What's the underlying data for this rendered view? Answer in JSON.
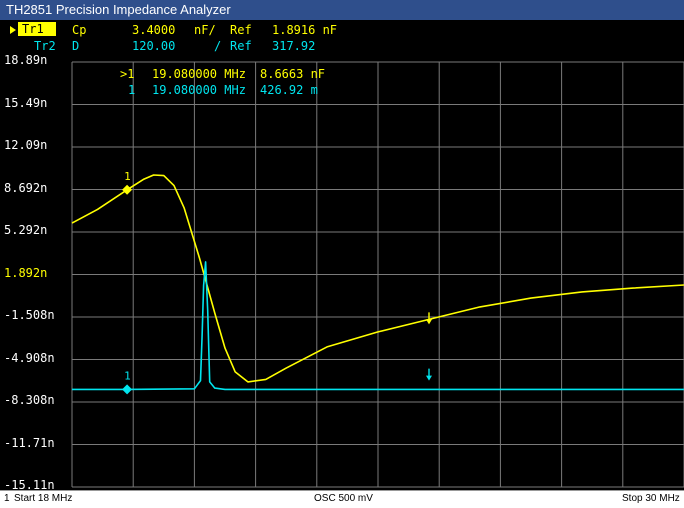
{
  "window": {
    "title": "TH2851 Precision Impedance Analyzer"
  },
  "traces": [
    {
      "label": "Tr1",
      "param": "Cp",
      "scale": "3.4000",
      "unit_sep": "nF/",
      "ref_label": "Ref",
      "ref_value": "1.8916 nF",
      "color": "#ffff00",
      "active": true
    },
    {
      "label": "Tr2",
      "param": "D",
      "scale": "120.00",
      "unit_sep": "/",
      "ref_label": "Ref",
      "ref_value": "317.92",
      "color": "#00e5ee",
      "active": false
    }
  ],
  "marker_readout": [
    {
      "prefix": ">1",
      "freq": "19.080000 MHz",
      "value": "8.6663 nF"
    },
    {
      "prefix": "1",
      "freq": "19.080000 MHz",
      "value": "426.92 m"
    }
  ],
  "y_axis_labels": [
    "18.89n",
    "15.49n",
    "12.09n",
    "8.692n",
    "5.292n",
    "1.892n",
    "-1.508n",
    "-4.908n",
    "-8.308n",
    "-11.71n",
    "-15.11n"
  ],
  "reference_label_index": 5,
  "marker_number_label": "1",
  "status": {
    "channel": "1",
    "start": "Start 18 MHz",
    "osc": "OSC 500 mV",
    "stop": "Stop 30 MHz"
  },
  "colors": {
    "background": "#000000",
    "grid": "#7a7a7a",
    "trace1": "#ffff00",
    "trace2": "#00e5ee",
    "axis_label": "#ffffff",
    "titlebar": "#2f4f8c"
  },
  "chart_data": {
    "type": "line",
    "x_range": [
      18,
      30
    ],
    "x_unit": "MHz",
    "y_range": [
      -15.11,
      18.89
    ],
    "series": [
      {
        "name": "Tr1",
        "param": "Cp",
        "x": [
          18,
          18.5,
          19.08,
          19.4,
          19.6,
          19.8,
          20.0,
          20.2,
          20.5,
          20.8,
          21.0,
          21.2,
          21.45,
          21.8,
          22.2,
          23.0,
          24.0,
          25.0,
          26.0,
          27.0,
          28.0,
          29.0,
          30.0
        ],
        "y": [
          6.0,
          7.1,
          8.67,
          9.5,
          9.85,
          9.8,
          9.0,
          7.2,
          3.2,
          -1.2,
          -4.0,
          -5.9,
          -6.7,
          -6.5,
          -5.6,
          -3.9,
          -2.7,
          -1.7,
          -0.7,
          0.0,
          0.5,
          0.8,
          1.05
        ]
      },
      {
        "name": "Tr2",
        "param": "D",
        "x": [
          18,
          19.08,
          20.4,
          20.52,
          20.55,
          20.58,
          20.62,
          20.66,
          20.7,
          20.8,
          21.0,
          24.0,
          30.0
        ],
        "y": [
          -7.3,
          -7.3,
          -7.25,
          -6.6,
          -3.0,
          1.0,
          2.9,
          -1.0,
          -6.7,
          -7.2,
          -7.3,
          -7.3,
          -7.3
        ]
      }
    ],
    "markers": [
      {
        "trace": "Tr1",
        "x": 19.08,
        "y": 8.6663
      },
      {
        "trace": "Tr2",
        "x": 19.08,
        "y": -7.3
      }
    ],
    "ref_arrows": [
      {
        "trace": "Tr1",
        "x": 25.0,
        "y": -2.1
      },
      {
        "trace": "Tr2",
        "x": 25.0,
        "y": -6.6
      }
    ],
    "grid": true
  }
}
